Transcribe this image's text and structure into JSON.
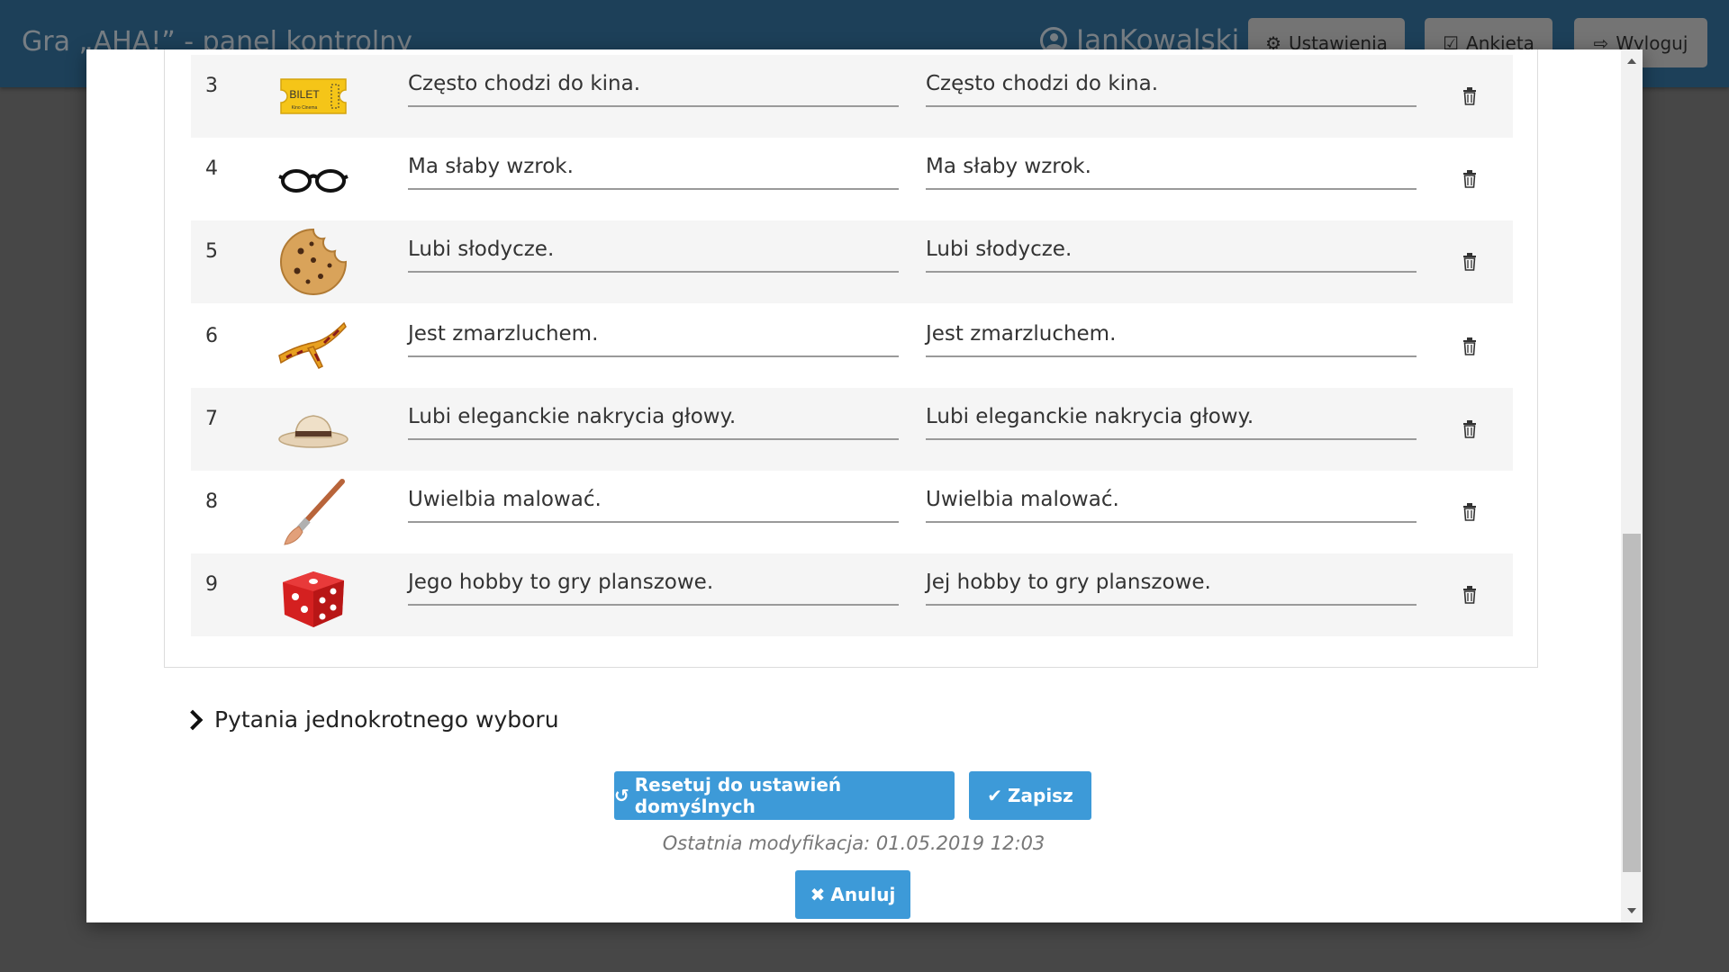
{
  "app": {
    "title": "Gra „AHA!” - panel kontrolny",
    "username": "JanKowalski",
    "buttons": {
      "settings": "Ustawienia",
      "survey": "Ankieta",
      "logout": "Wyloguj"
    }
  },
  "rows": [
    {
      "num": "3",
      "icon": "ticket-icon",
      "ticket_text": "BILET",
      "ticket_sub": "Kino Cinema",
      "male": "Często chodzi do kina.",
      "female": "Często chodzi do kina."
    },
    {
      "num": "4",
      "icon": "glasses-icon",
      "male": "Ma słaby wzrok.",
      "female": "Ma słaby wzrok."
    },
    {
      "num": "5",
      "icon": "cookie-icon",
      "male": "Lubi słodycze.",
      "female": "Lubi słodycze."
    },
    {
      "num": "6",
      "icon": "scarf-icon",
      "male": "Jest zmarzluchem.",
      "female": "Jest zmarzluchem."
    },
    {
      "num": "7",
      "icon": "hat-icon",
      "male": "Lubi eleganckie nakrycia głowy.",
      "female": "Lubi eleganckie nakrycia głowy."
    },
    {
      "num": "8",
      "icon": "paintbrush-icon",
      "male": "Uwielbia malować.",
      "female": "Uwielbia malować."
    },
    {
      "num": "9",
      "icon": "dice-icon",
      "male": "Jego hobby to gry planszowe.",
      "female": "Jej hobby to gry planszowe."
    }
  ],
  "section": {
    "single_choice_label": "Pytania jednokrotnego wyboru"
  },
  "actions": {
    "reset_label": "Resetuj do ustawień domyślnych",
    "save_label": "Zapisz",
    "cancel_label": "Anuluj",
    "last_modified": "Ostatnia modyfikacja: 01.05.2019 12:03"
  },
  "colors": {
    "header": "#336f99",
    "button": "#3d9ad8"
  }
}
